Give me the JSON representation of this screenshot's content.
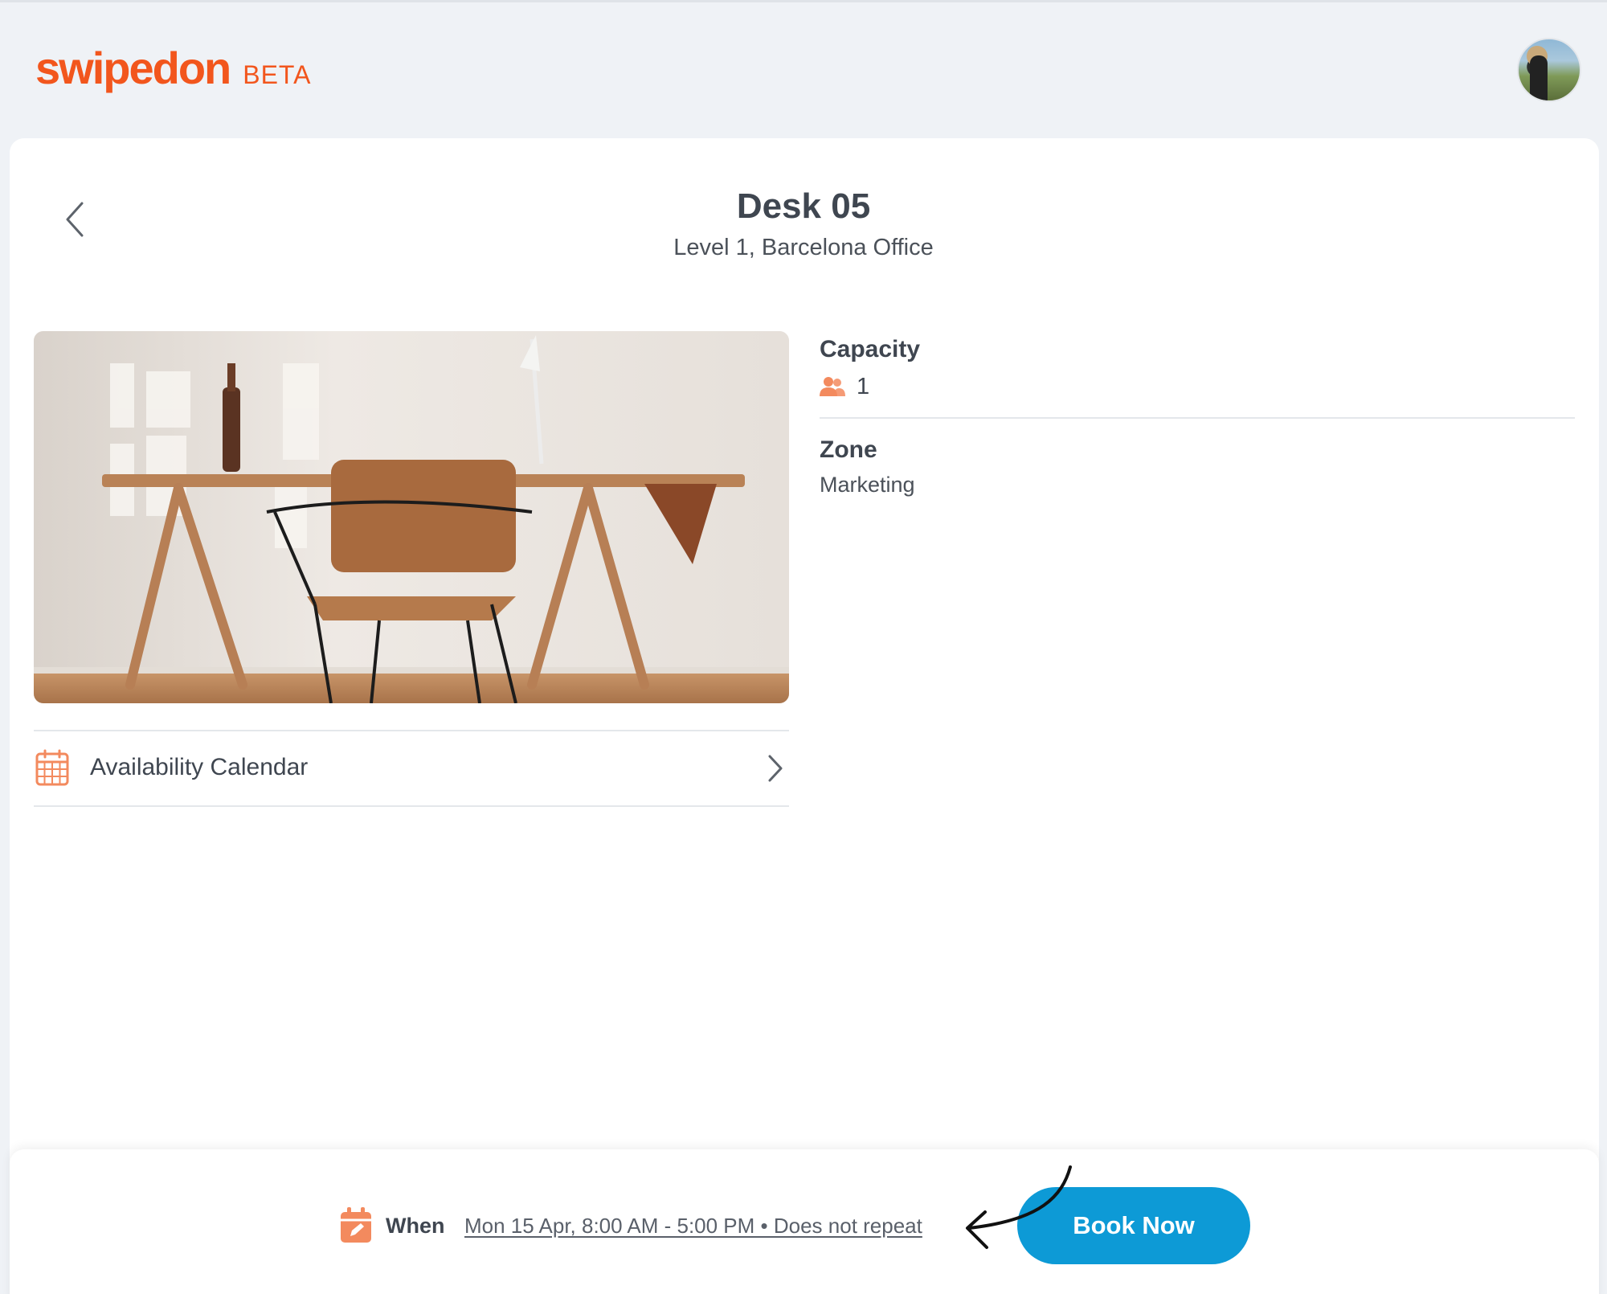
{
  "header": {
    "logo_text": "swipedon",
    "logo_badge": "BETA",
    "brand_color": "#f2561d"
  },
  "resource": {
    "title": "Desk 05",
    "location": "Level 1, Barcelona Office",
    "photo_description_icon": "desk-photo"
  },
  "availability": {
    "label": "Availability Calendar"
  },
  "properties": {
    "capacity_label": "Capacity",
    "capacity_value": "1",
    "zone_label": "Zone",
    "zone_value": "Marketing"
  },
  "booking": {
    "when_label": "When",
    "when_value": "Mon 15 Apr, 8:00 AM - 5:00 PM • Does not repeat",
    "book_button": "Book Now",
    "button_color": "#0d9ad6"
  }
}
